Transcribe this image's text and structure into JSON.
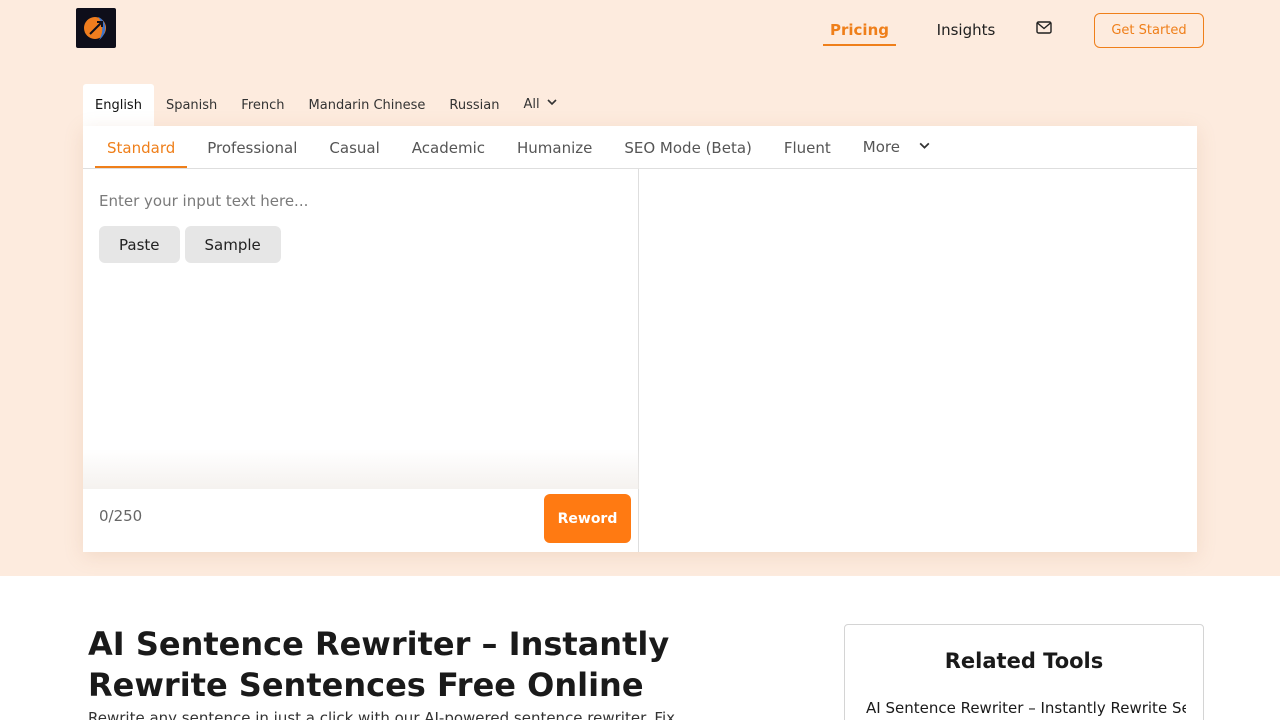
{
  "header": {
    "logo_icon": "phoenix-logo-icon",
    "nav": [
      {
        "label": "Pricing",
        "active": true
      },
      {
        "label": "Insights",
        "active": false
      }
    ],
    "mail_icon": "mail-icon",
    "cta_label": "Get Started"
  },
  "languages": {
    "tabs": [
      "English",
      "Spanish",
      "French",
      "Mandarin Chinese",
      "Russian"
    ],
    "active": "English",
    "all_label": "All"
  },
  "modes": {
    "tabs": [
      "Standard",
      "Professional",
      "Casual",
      "Academic",
      "Humanize",
      "SEO Mode (Beta)",
      "Fluent"
    ],
    "active": "Standard",
    "more_label": "More"
  },
  "editor": {
    "placeholder": "Enter your input text here...",
    "paste_label": "Paste",
    "sample_label": "Sample",
    "counter": "0/250",
    "reword_label": "Reword"
  },
  "content": {
    "headline": "AI Sentence Rewriter – Instantly Rewrite Sentences Free Online",
    "subtext": "Rewrite any sentence in just a click with our AI-powered sentence rewriter. Fix"
  },
  "related": {
    "title": "Related Tools",
    "items": [
      "AI Sentence Rewriter – Instantly Rewrite Sentences Free Online"
    ]
  },
  "colors": {
    "accent": "#ef7f1a",
    "button": "#ff7a12",
    "hero_bg": "#fdebde"
  }
}
